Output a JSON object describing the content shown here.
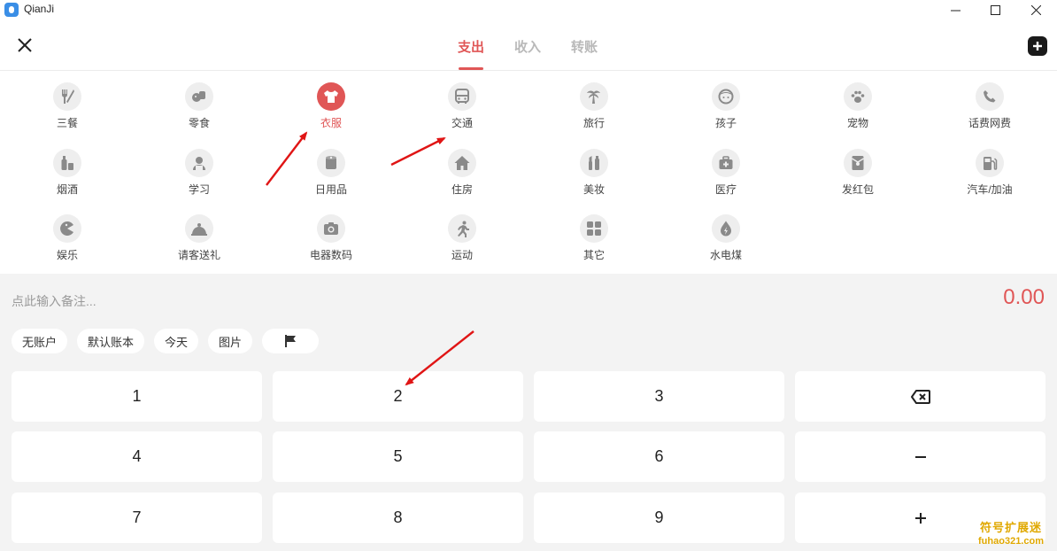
{
  "window": {
    "title": "QianJi"
  },
  "header": {
    "tabs": [
      {
        "label": "支出",
        "active": true
      },
      {
        "label": "收入",
        "active": false
      },
      {
        "label": "转账",
        "active": false
      }
    ]
  },
  "categories": [
    {
      "label": "三餐",
      "icon": "utensils-icon"
    },
    {
      "label": "零食",
      "icon": "snack-icon"
    },
    {
      "label": "衣服",
      "icon": "shirt-icon",
      "selected": true
    },
    {
      "label": "交通",
      "icon": "bus-icon"
    },
    {
      "label": "旅行",
      "icon": "palm-tree-icon"
    },
    {
      "label": "孩子",
      "icon": "child-icon"
    },
    {
      "label": "宠物",
      "icon": "paw-icon"
    },
    {
      "label": "话费网费",
      "icon": "phone-icon"
    },
    {
      "label": "烟酒",
      "icon": "bottle-icon"
    },
    {
      "label": "学习",
      "icon": "student-icon"
    },
    {
      "label": "日用品",
      "icon": "tissue-roll-icon"
    },
    {
      "label": "住房",
      "icon": "house-icon"
    },
    {
      "label": "美妆",
      "icon": "cosmetics-icon"
    },
    {
      "label": "医疗",
      "icon": "medical-kit-icon"
    },
    {
      "label": "发红包",
      "icon": "red-envelope-icon"
    },
    {
      "label": "汽车/加油",
      "icon": "fuel-pump-icon"
    },
    {
      "label": "娱乐",
      "icon": "pacman-icon"
    },
    {
      "label": "请客送礼",
      "icon": "gift-icon"
    },
    {
      "label": "电器数码",
      "icon": "camera-icon"
    },
    {
      "label": "运动",
      "icon": "running-icon"
    },
    {
      "label": "其它",
      "icon": "grid-icon"
    },
    {
      "label": "水电煤",
      "icon": "water-drop-icon"
    }
  ],
  "entry": {
    "remark_placeholder": "点此输入备注...",
    "amount": "0.00"
  },
  "chips": [
    "无账户",
    "默认账本",
    "今天",
    "图片"
  ],
  "keypad": {
    "rows": [
      [
        "1",
        "2",
        "3"
      ],
      [
        "4",
        "5",
        "6"
      ],
      [
        "7",
        "8",
        "9"
      ]
    ]
  },
  "watermark": {
    "line1": "符号扩展迷",
    "line2": "fuhao321.com"
  },
  "colors": {
    "accent": "#e05656",
    "icon_gray": "#8a8a8a",
    "panel_bg": "#f3f3f3"
  }
}
